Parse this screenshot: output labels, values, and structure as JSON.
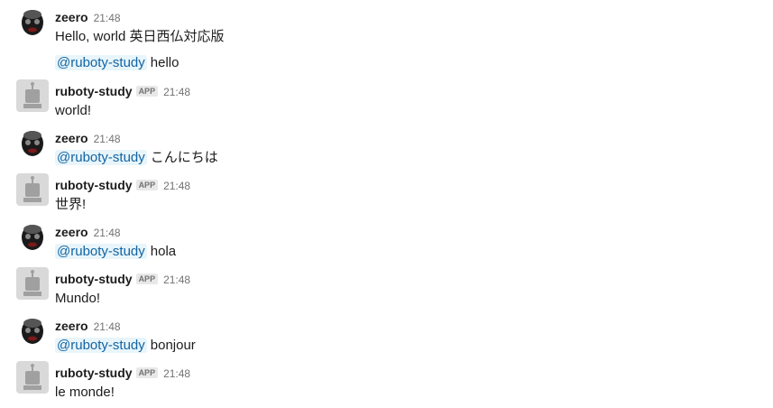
{
  "messages": [
    {
      "user": "zeero",
      "avatar_icon": "zeero-avatar-icon",
      "time": "21:48",
      "text": "Hello, world 英日西仏対応版"
    },
    {
      "continuation": true,
      "mention": "@ruboty-study",
      "text": "hello"
    },
    {
      "user": "ruboty-study",
      "avatar_icon": "robot-avatar-icon",
      "badge": "APP",
      "time": "21:48",
      "text": "world!"
    },
    {
      "user": "zeero",
      "avatar_icon": "zeero-avatar-icon",
      "time": "21:48",
      "mention": "@ruboty-study",
      "text": "こんにちは"
    },
    {
      "user": "ruboty-study",
      "avatar_icon": "robot-avatar-icon",
      "badge": "APP",
      "time": "21:48",
      "text": "世界!"
    },
    {
      "user": "zeero",
      "avatar_icon": "zeero-avatar-icon",
      "time": "21:48",
      "mention": "@ruboty-study",
      "text": "hola"
    },
    {
      "user": "ruboty-study",
      "avatar_icon": "robot-avatar-icon",
      "badge": "APP",
      "time": "21:48",
      "text": "Mundo!"
    },
    {
      "user": "zeero",
      "avatar_icon": "zeero-avatar-icon",
      "time": "21:48",
      "mention": "@ruboty-study",
      "text": "bonjour"
    },
    {
      "user": "ruboty-study",
      "avatar_icon": "robot-avatar-icon",
      "badge": "APP",
      "time": "21:48",
      "text": "le monde!"
    }
  ],
  "colors": {
    "mention_bg": "#e8f5fa",
    "mention_text": "#1264a3",
    "timestamp": "#717274",
    "badge_bg": "#e8e8e8"
  }
}
